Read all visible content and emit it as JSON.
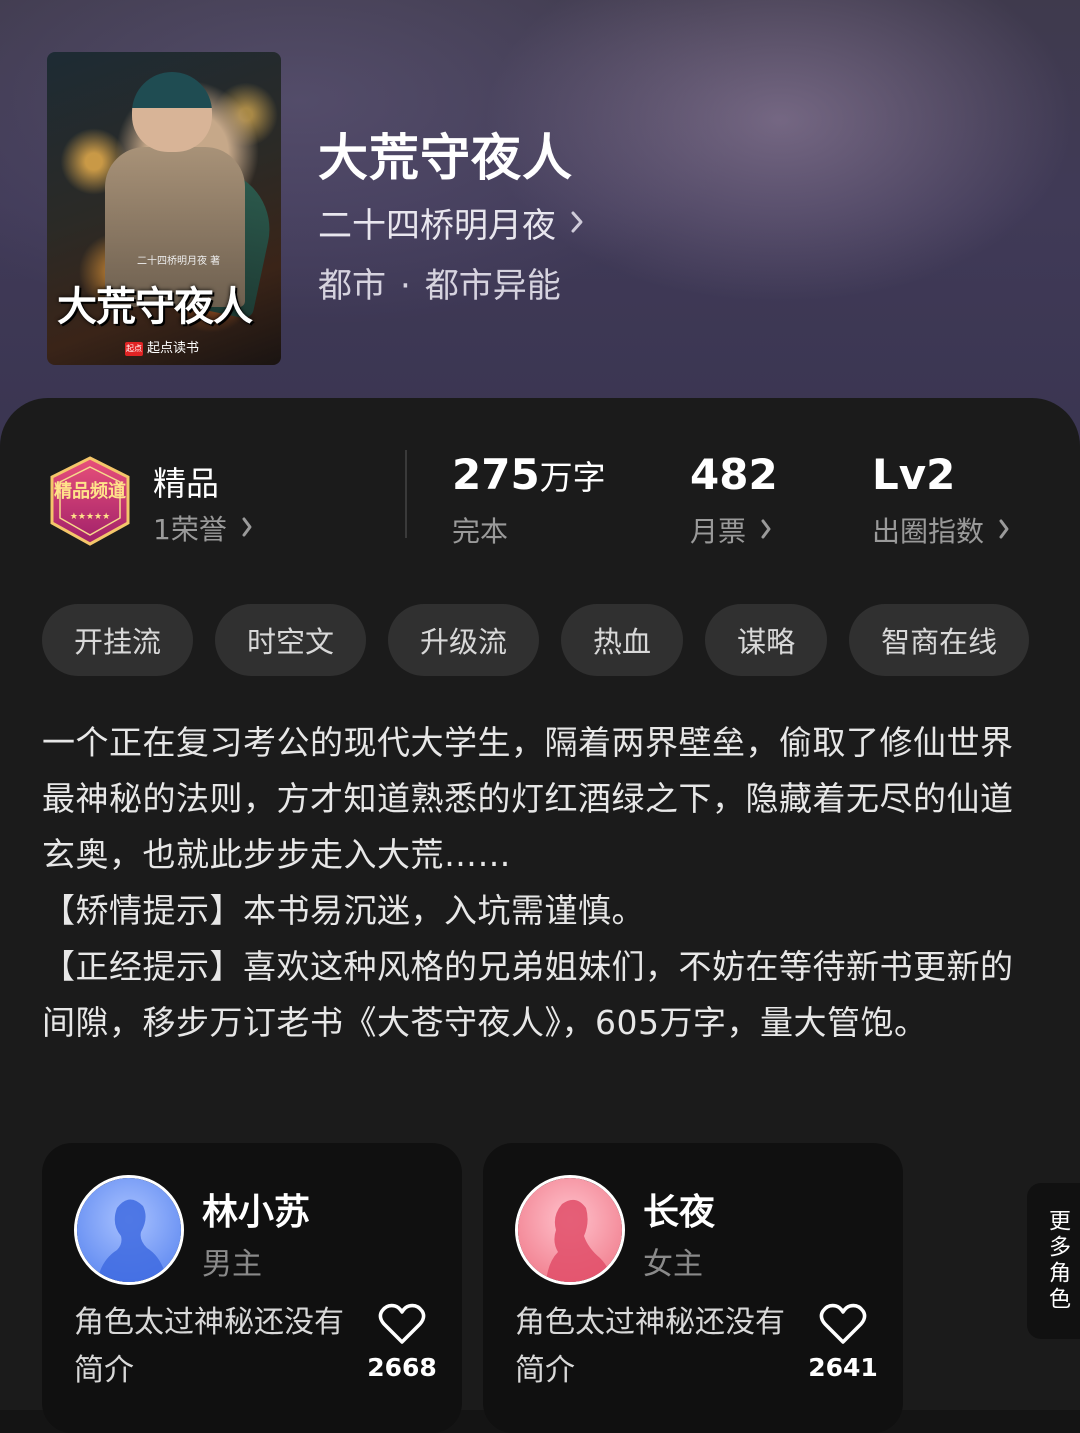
{
  "book": {
    "title": "大荒守夜人",
    "author": "二十四桥明月夜",
    "category": "都市",
    "subcategory": "都市异能",
    "separator": "·"
  },
  "cover": {
    "title": "大荒守夜人",
    "author_line": "二十四桥明月夜 著",
    "brand": "起点读书",
    "brand_badge": "起点"
  },
  "stats": {
    "quality": {
      "label": "精品",
      "sub": "1荣誉",
      "badge_text": "精品频道"
    },
    "words": {
      "value": "275",
      "unit": "万字",
      "sub": "完本"
    },
    "tickets": {
      "value": "482",
      "sub": "月票"
    },
    "influence": {
      "value": "Lv2",
      "sub": "出圈指数"
    }
  },
  "tags": [
    "开挂流",
    "时空文",
    "升级流",
    "热血",
    "谋略",
    "智商在线"
  ],
  "description": [
    "一个正在复习考公的现代大学生，隔着两界壁垒，偷取了修仙世界最神秘的法则，方才知道熟悉的灯红酒绿之下，隐藏着无尽的仙道玄奥，也就此步步走入大荒……",
    "【矫情提示】本书易沉迷，入坑需谨慎。",
    "【正经提示】喜欢这种风格的兄弟姐妹们，不妨在等待新书更新的间隙，移步万订老书《大苍守夜人》，605万字，量大管饱。"
  ],
  "characters": [
    {
      "name": "林小苏",
      "role": "男主",
      "intro": "角色太过神秘还没有简介",
      "likes": "2668",
      "avatar_color": "#5b86f0"
    },
    {
      "name": "长夜",
      "role": "女主",
      "intro": "角色太过神秘还没有简介",
      "likes": "2641",
      "avatar_color": "#f07a8a"
    }
  ],
  "more_roles": "更多角色",
  "icons": {
    "chevron": "chevron-right-icon",
    "heart": "heart-outline-icon"
  }
}
